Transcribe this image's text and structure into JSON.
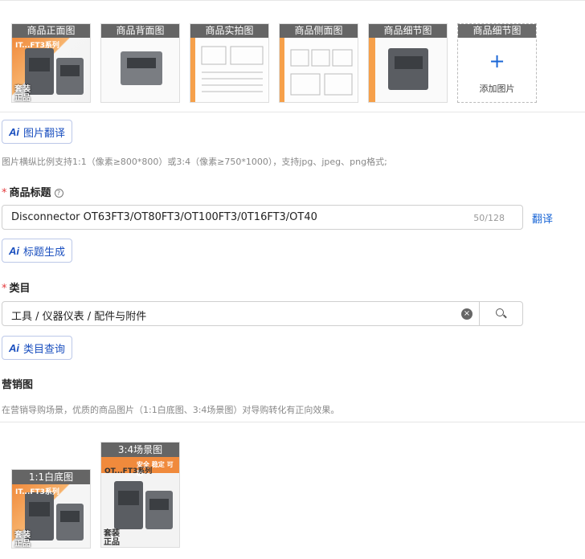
{
  "images": {
    "thumbs": [
      {
        "caption": "商品正面图",
        "overlay_top": "IT...FT3系列",
        "overlay_bottom": "套装\n正品"
      },
      {
        "caption": "商品背面图"
      },
      {
        "caption": "商品实拍图"
      },
      {
        "caption": "商品侧面图"
      },
      {
        "caption": "商品细节图"
      }
    ],
    "add": {
      "caption": "商品细节图",
      "label": "添加图片"
    },
    "ai_translate": "图片翻译",
    "hint": "图片横纵比例支持1:1（像素≥800*800）或3:4（像素≥750*1000），支持jpg、jpeg、png格式;"
  },
  "title_field": {
    "label": "商品标题",
    "value": "Disconnector OT63FT3/OT80FT3/OT100FT3/0T16FT3/OT40",
    "count": "50/128",
    "translate": "翻译",
    "ai_generate": "标题生成"
  },
  "category_field": {
    "label": "类目",
    "value": "工具 / 仪器仪表 / 配件与附件",
    "ai_query": "类目查询"
  },
  "marketing": {
    "label": "营销图",
    "hint": "在营销导购场景，优质的商品图片（1:1白底图、3:4场景图）对导购转化有正向效果。",
    "white": {
      "caption": "1:1白底图",
      "overlay_top": "IT...FT3系列",
      "overlay_bottom": "套装\n正品"
    },
    "scene": {
      "caption": "3:4场景图",
      "overlay_top": "安全 稳定 可靠",
      "overlay_mid": "OT...FT3系列",
      "overlay_bottom": "套装\n正品"
    }
  },
  "ai_mark": "Ai",
  "colors": {
    "link": "#1a66d6",
    "ai": "#1a4fbf",
    "required": "#e4393c"
  }
}
